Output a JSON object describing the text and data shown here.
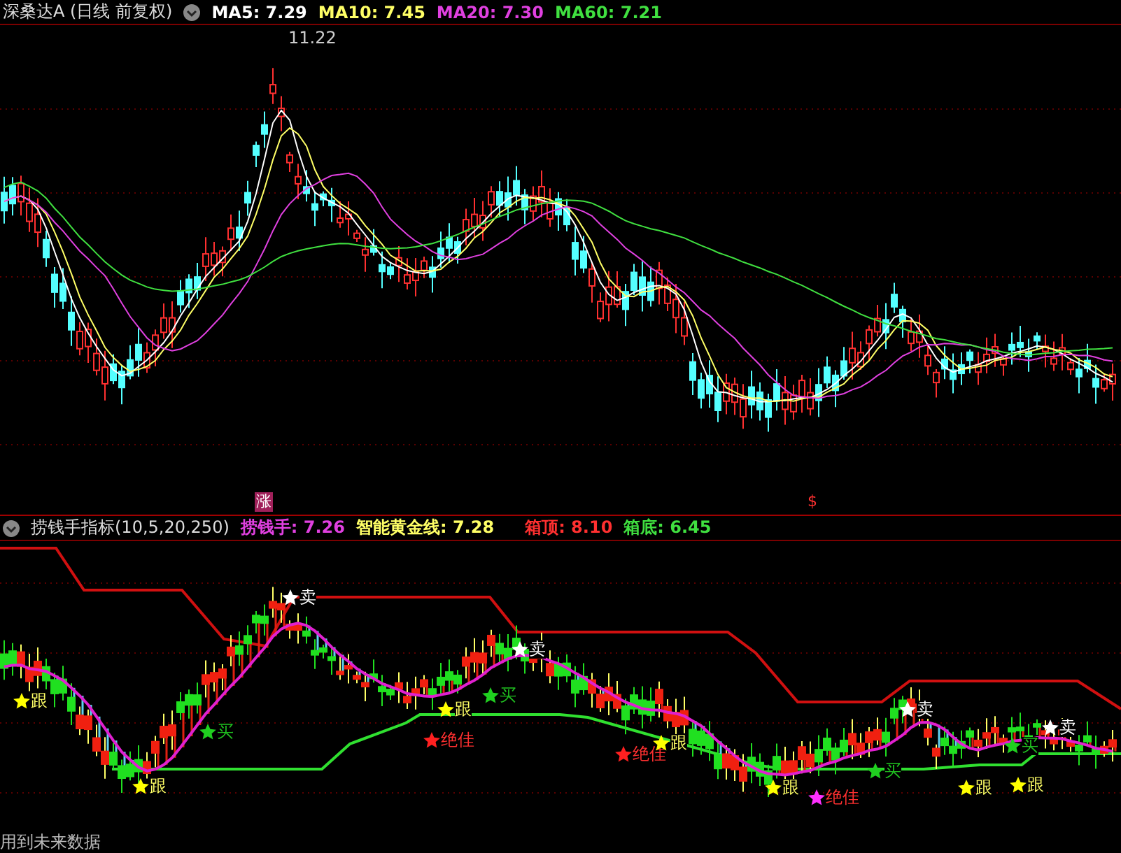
{
  "main_chart": {
    "title": "深桑达A",
    "period": "(日线 前复权)",
    "indicators": [
      {
        "label": "MA5: 7.29",
        "color": "#ffffff"
      },
      {
        "label": "MA10: 7.45",
        "color": "#ffff66"
      },
      {
        "label": "MA20: 7.30",
        "color": "#e040e0"
      },
      {
        "label": "MA60: 7.21",
        "color": "#40e040"
      }
    ],
    "peak_label": "11.22"
  },
  "markers": [
    {
      "text": "涨",
      "kind": "rise"
    },
    {
      "text": "$",
      "kind": "dollar"
    }
  ],
  "indicator_panel": {
    "title": "捞钱手指标(10,5,20,250)",
    "values": [
      {
        "label": "捞钱手: 7.26",
        "kind": "hand"
      },
      {
        "label": "智能黄金线: 7.28",
        "kind": "trend"
      },
      {
        "label": "箱顶: 8.10",
        "kind": "top"
      },
      {
        "label": "箱底: 6.45",
        "kind": "bottom"
      }
    ],
    "signals": [
      {
        "text": "跟",
        "kind": "follow",
        "color": "#ffff00"
      },
      {
        "text": "跟",
        "kind": "follow",
        "color": "#ffff00"
      },
      {
        "text": "买",
        "kind": "buy",
        "color": "#20d020"
      },
      {
        "text": "卖",
        "kind": "sell",
        "color": "#ffffff"
      },
      {
        "text": "跟",
        "kind": "follow",
        "color": "#ffff00"
      },
      {
        "text": "绝佳",
        "kind": "best",
        "color": "#ff2020"
      },
      {
        "text": "买",
        "kind": "buy",
        "color": "#20d020"
      },
      {
        "text": "卖",
        "kind": "sell",
        "color": "#ffffff"
      },
      {
        "text": "绝佳",
        "kind": "best",
        "color": "#ff2020"
      },
      {
        "text": "跟",
        "kind": "follow",
        "color": "#ffff00"
      },
      {
        "text": "跟",
        "kind": "follow",
        "color": "#ffff00"
      },
      {
        "text": "绝佳",
        "kind": "best",
        "color": "#ff30ff"
      },
      {
        "text": "买",
        "kind": "buy",
        "color": "#20d020"
      },
      {
        "text": "卖",
        "kind": "sell",
        "color": "#ffffff"
      },
      {
        "text": "跟",
        "kind": "follow",
        "color": "#ffff00"
      },
      {
        "text": "买",
        "kind": "buy",
        "color": "#20d020"
      },
      {
        "text": "跟",
        "kind": "follow",
        "color": "#ffff00"
      },
      {
        "text": "卖",
        "kind": "sell",
        "color": "#ffffff"
      }
    ]
  },
  "footer": "用到未来数据"
}
